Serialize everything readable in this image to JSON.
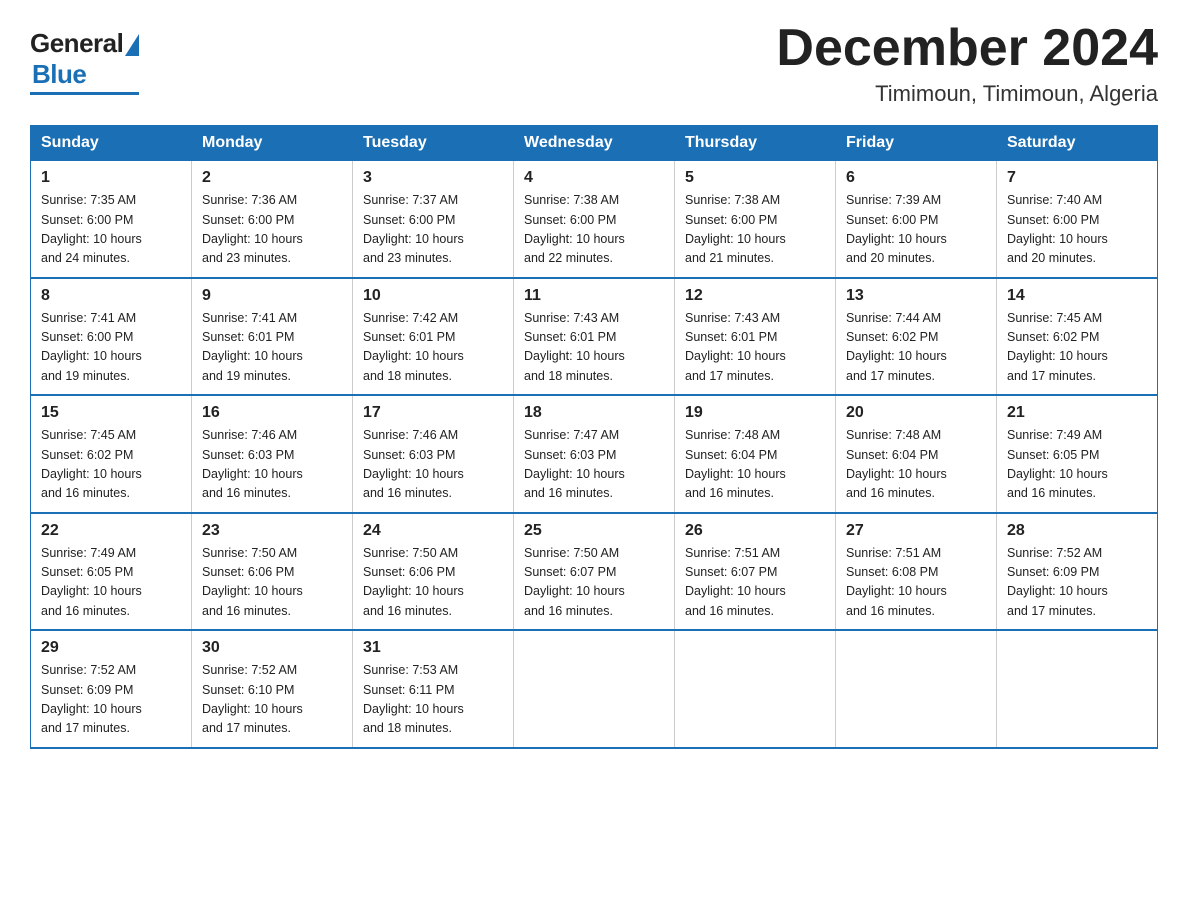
{
  "logo": {
    "general": "General",
    "blue": "Blue"
  },
  "header": {
    "month": "December 2024",
    "location": "Timimoun, Timimoun, Algeria"
  },
  "days_of_week": [
    "Sunday",
    "Monday",
    "Tuesday",
    "Wednesday",
    "Thursday",
    "Friday",
    "Saturday"
  ],
  "weeks": [
    [
      {
        "day": "1",
        "sunrise": "7:35 AM",
        "sunset": "6:00 PM",
        "daylight": "10 hours and 24 minutes."
      },
      {
        "day": "2",
        "sunrise": "7:36 AM",
        "sunset": "6:00 PM",
        "daylight": "10 hours and 23 minutes."
      },
      {
        "day": "3",
        "sunrise": "7:37 AM",
        "sunset": "6:00 PM",
        "daylight": "10 hours and 23 minutes."
      },
      {
        "day": "4",
        "sunrise": "7:38 AM",
        "sunset": "6:00 PM",
        "daylight": "10 hours and 22 minutes."
      },
      {
        "day": "5",
        "sunrise": "7:38 AM",
        "sunset": "6:00 PM",
        "daylight": "10 hours and 21 minutes."
      },
      {
        "day": "6",
        "sunrise": "7:39 AM",
        "sunset": "6:00 PM",
        "daylight": "10 hours and 20 minutes."
      },
      {
        "day": "7",
        "sunrise": "7:40 AM",
        "sunset": "6:00 PM",
        "daylight": "10 hours and 20 minutes."
      }
    ],
    [
      {
        "day": "8",
        "sunrise": "7:41 AM",
        "sunset": "6:00 PM",
        "daylight": "10 hours and 19 minutes."
      },
      {
        "day": "9",
        "sunrise": "7:41 AM",
        "sunset": "6:01 PM",
        "daylight": "10 hours and 19 minutes."
      },
      {
        "day": "10",
        "sunrise": "7:42 AM",
        "sunset": "6:01 PM",
        "daylight": "10 hours and 18 minutes."
      },
      {
        "day": "11",
        "sunrise": "7:43 AM",
        "sunset": "6:01 PM",
        "daylight": "10 hours and 18 minutes."
      },
      {
        "day": "12",
        "sunrise": "7:43 AM",
        "sunset": "6:01 PM",
        "daylight": "10 hours and 17 minutes."
      },
      {
        "day": "13",
        "sunrise": "7:44 AM",
        "sunset": "6:02 PM",
        "daylight": "10 hours and 17 minutes."
      },
      {
        "day": "14",
        "sunrise": "7:45 AM",
        "sunset": "6:02 PM",
        "daylight": "10 hours and 17 minutes."
      }
    ],
    [
      {
        "day": "15",
        "sunrise": "7:45 AM",
        "sunset": "6:02 PM",
        "daylight": "10 hours and 16 minutes."
      },
      {
        "day": "16",
        "sunrise": "7:46 AM",
        "sunset": "6:03 PM",
        "daylight": "10 hours and 16 minutes."
      },
      {
        "day": "17",
        "sunrise": "7:46 AM",
        "sunset": "6:03 PM",
        "daylight": "10 hours and 16 minutes."
      },
      {
        "day": "18",
        "sunrise": "7:47 AM",
        "sunset": "6:03 PM",
        "daylight": "10 hours and 16 minutes."
      },
      {
        "day": "19",
        "sunrise": "7:48 AM",
        "sunset": "6:04 PM",
        "daylight": "10 hours and 16 minutes."
      },
      {
        "day": "20",
        "sunrise": "7:48 AM",
        "sunset": "6:04 PM",
        "daylight": "10 hours and 16 minutes."
      },
      {
        "day": "21",
        "sunrise": "7:49 AM",
        "sunset": "6:05 PM",
        "daylight": "10 hours and 16 minutes."
      }
    ],
    [
      {
        "day": "22",
        "sunrise": "7:49 AM",
        "sunset": "6:05 PM",
        "daylight": "10 hours and 16 minutes."
      },
      {
        "day": "23",
        "sunrise": "7:50 AM",
        "sunset": "6:06 PM",
        "daylight": "10 hours and 16 minutes."
      },
      {
        "day": "24",
        "sunrise": "7:50 AM",
        "sunset": "6:06 PM",
        "daylight": "10 hours and 16 minutes."
      },
      {
        "day": "25",
        "sunrise": "7:50 AM",
        "sunset": "6:07 PM",
        "daylight": "10 hours and 16 minutes."
      },
      {
        "day": "26",
        "sunrise": "7:51 AM",
        "sunset": "6:07 PM",
        "daylight": "10 hours and 16 minutes."
      },
      {
        "day": "27",
        "sunrise": "7:51 AM",
        "sunset": "6:08 PM",
        "daylight": "10 hours and 16 minutes."
      },
      {
        "day": "28",
        "sunrise": "7:52 AM",
        "sunset": "6:09 PM",
        "daylight": "10 hours and 17 minutes."
      }
    ],
    [
      {
        "day": "29",
        "sunrise": "7:52 AM",
        "sunset": "6:09 PM",
        "daylight": "10 hours and 17 minutes."
      },
      {
        "day": "30",
        "sunrise": "7:52 AM",
        "sunset": "6:10 PM",
        "daylight": "10 hours and 17 minutes."
      },
      {
        "day": "31",
        "sunrise": "7:53 AM",
        "sunset": "6:11 PM",
        "daylight": "10 hours and 18 minutes."
      },
      null,
      null,
      null,
      null
    ]
  ],
  "labels": {
    "sunrise": "Sunrise: ",
    "sunset": "Sunset: ",
    "daylight": "Daylight: "
  }
}
